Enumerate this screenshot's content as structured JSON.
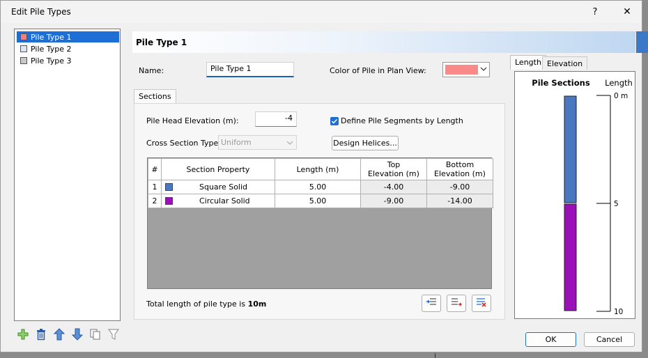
{
  "window": {
    "title": "Edit Pile Types",
    "help_label": "?",
    "close_label": "✕"
  },
  "pile_types": [
    {
      "label": "Pile Type 1",
      "color": "#f08080",
      "selected": true
    },
    {
      "label": "Pile Type 2",
      "color": "#d9e8f3",
      "selected": false
    },
    {
      "label": "Pile Type 3",
      "color": "#c8c8c8",
      "selected": false
    }
  ],
  "toolbar_icons": [
    "add-icon",
    "delete-icon",
    "move-up-icon",
    "move-down-icon",
    "copy-icon",
    "filter-icon"
  ],
  "header": {
    "title": "Pile Type 1"
  },
  "name": {
    "label": "Name:",
    "value": "Pile Type 1"
  },
  "plan_color": {
    "label": "Color of Pile in Plan View:",
    "value": "#f88a8a"
  },
  "tabs": {
    "sections": "Sections"
  },
  "head_elevation": {
    "label": "Pile Head Elevation (m):",
    "value": "-4"
  },
  "define_by_length": {
    "label": "Define Pile Segments by Length",
    "checked": true
  },
  "cross_section": {
    "label": "Cross Section Type:",
    "value": "Uniform"
  },
  "design_helices_label": "Design Helices...",
  "table": {
    "headers": {
      "num": "#",
      "prop": "Section Property",
      "length": "Length (m)",
      "top1": "Top",
      "top2": "Elevation (m)",
      "bot1": "Bottom",
      "bot2": "Elevation (m)"
    },
    "rows": [
      {
        "num": "1",
        "color": "#4a78c0",
        "property": "Square Solid",
        "length": "5.00",
        "top": "-4.00",
        "bottom": "-9.00"
      },
      {
        "num": "2",
        "color": "#9a10b8",
        "property": "Circular Solid",
        "length": "5.00",
        "top": "-9.00",
        "bottom": "-14.00"
      }
    ]
  },
  "total": {
    "prefix": "Total length of pile type is ",
    "value": "10m"
  },
  "view_tabs": {
    "length": "Length",
    "elevation": "Elevation"
  },
  "diagram": {
    "title": "Pile Sections",
    "axis_label": "Length",
    "ticks": [
      {
        "label": "0 m",
        "value": 0
      },
      {
        "label": "5",
        "value": 5
      },
      {
        "label": "10",
        "value": 10
      }
    ],
    "segments": [
      {
        "color": "#4a78c0",
        "from": 0,
        "to": 5
      },
      {
        "color": "#9a10b8",
        "from": 5,
        "to": 10
      }
    ]
  },
  "buttons": {
    "ok": "OK",
    "cancel": "Cancel"
  }
}
